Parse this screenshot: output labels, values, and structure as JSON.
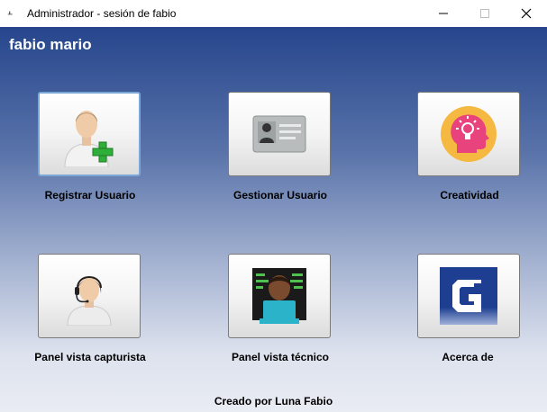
{
  "window": {
    "title": "Administrador - sesión de fabio",
    "icon": "app-icon"
  },
  "header": {
    "user_name": "fabio mario"
  },
  "tiles": [
    {
      "label": "Registrar Usuario",
      "icon": "add-user-icon"
    },
    {
      "label": "Gestionar Usuario",
      "icon": "id-card-icon"
    },
    {
      "label": "Creatividad",
      "icon": "creativity-head-icon"
    },
    {
      "label": "Panel vista capturista",
      "icon": "support-agent-icon"
    },
    {
      "label": "Panel vista técnico",
      "icon": "technician-computer-icon"
    },
    {
      "label": "Acerca de",
      "icon": "about-logo-icon"
    }
  ],
  "footer": {
    "credit": "Creado por Luna Fabio"
  },
  "colors": {
    "header_gradient_top": "#26458c",
    "header_gradient_bottom": "#e9ecf3",
    "plus_green": "#2fae3a",
    "creativity_orange": "#f5b942",
    "creativity_pink": "#e8437d"
  }
}
